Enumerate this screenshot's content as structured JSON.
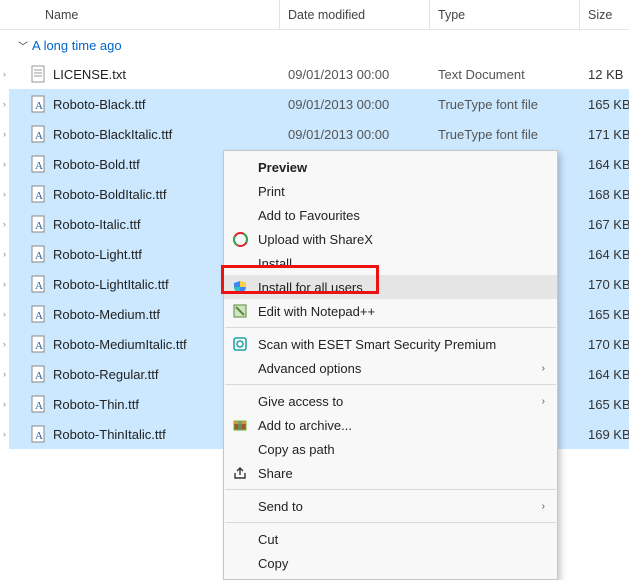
{
  "columns": {
    "name": "Name",
    "date": "Date modified",
    "type": "Type",
    "size": "Size"
  },
  "group": "A long time ago",
  "rows": [
    {
      "name": "LICENSE.txt",
      "date": "09/01/2013 00:00",
      "type": "Text Document",
      "size": "12 KB",
      "kind": "text",
      "sel": false
    },
    {
      "name": "Roboto-Black.ttf",
      "date": "09/01/2013 00:00",
      "type": "TrueType font file",
      "size": "165 KB",
      "kind": "font",
      "sel": true
    },
    {
      "name": "Roboto-BlackItalic.ttf",
      "date": "09/01/2013 00:00",
      "type": "TrueType font file",
      "size": "171 KB",
      "kind": "font",
      "sel": true
    },
    {
      "name": "Roboto-Bold.ttf",
      "date": "",
      "type": "",
      "size": "164 KB",
      "kind": "font",
      "sel": true
    },
    {
      "name": "Roboto-BoldItalic.ttf",
      "date": "",
      "type": "",
      "size": "168 KB",
      "kind": "font",
      "sel": true
    },
    {
      "name": "Roboto-Italic.ttf",
      "date": "",
      "type": "",
      "size": "167 KB",
      "kind": "font",
      "sel": true
    },
    {
      "name": "Roboto-Light.ttf",
      "date": "",
      "type": "",
      "size": "164 KB",
      "kind": "font",
      "sel": true
    },
    {
      "name": "Roboto-LightItalic.ttf",
      "date": "",
      "type": "",
      "size": "170 KB",
      "kind": "font",
      "sel": true
    },
    {
      "name": "Roboto-Medium.ttf",
      "date": "",
      "type": "",
      "size": "165 KB",
      "kind": "font",
      "sel": true
    },
    {
      "name": "Roboto-MediumItalic.ttf",
      "date": "",
      "type": "",
      "size": "170 KB",
      "kind": "font",
      "sel": true
    },
    {
      "name": "Roboto-Regular.ttf",
      "date": "",
      "type": "",
      "size": "164 KB",
      "kind": "font",
      "sel": true
    },
    {
      "name": "Roboto-Thin.ttf",
      "date": "",
      "type": "",
      "size": "165 KB",
      "kind": "font",
      "sel": true
    },
    {
      "name": "Roboto-ThinItalic.ttf",
      "date": "",
      "type": "",
      "size": "169 KB",
      "kind": "font",
      "sel": true
    }
  ],
  "ctx": {
    "preview": "Preview",
    "print": "Print",
    "fav": "Add to Favourites",
    "sharex": "Upload with ShareX",
    "install": "Install",
    "install_all": "Install for all users",
    "npp": "Edit with Notepad++",
    "eset": "Scan with ESET Smart Security Premium",
    "adv": "Advanced options",
    "give": "Give access to",
    "archive": "Add to archive...",
    "copy_path": "Copy as path",
    "share": "Share",
    "send": "Send to",
    "cut": "Cut",
    "copy": "Copy"
  }
}
